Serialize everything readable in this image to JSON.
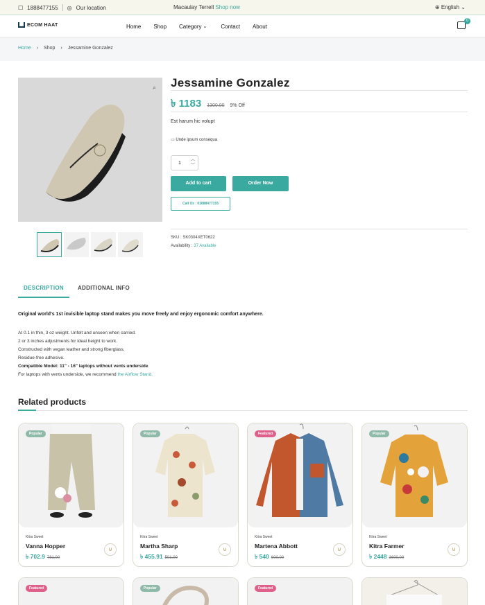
{
  "topbar": {
    "phone": "1888477155",
    "location": "Our location",
    "promo_name": "Macaulay Terrell",
    "promo_link": "Shop now",
    "language": "English"
  },
  "brand": {
    "name": "ECOM HAAT"
  },
  "nav": {
    "items": [
      "Home",
      "Shop",
      "Category",
      "Contact",
      "About"
    ],
    "cart_count": "0"
  },
  "breadcrumb": {
    "home": "Home",
    "shop": "Shop",
    "current": "Jessamine Gonzalez"
  },
  "product": {
    "title": "Jessamine Gonzalez",
    "price": "৳ 1183",
    "old_price": "1300.00",
    "discount": "9% Off",
    "short_desc": "Est harum hic volupt",
    "unde": "Unde ipsum consequa",
    "qty": "1",
    "add_to_cart": "Add to cart",
    "order_now": "Order Now",
    "call_us": "Call Us : 01888477155",
    "sku_label": "SKU :",
    "sku": "SK0304XET0622",
    "availability_label": "Availability :",
    "availability": "37 Available"
  },
  "tabs": {
    "description": "DESCRIPTION",
    "additional": "ADDITIONAL INFO"
  },
  "description": {
    "lead": "Original world's 1st invisible laptop stand makes you move freely and enjoy ergonomic comfort anywhere.",
    "lines": [
      "At 0.1 in thin, 3 oz weight. Unfelt and unseen when carried.",
      "2 or 3 inches adjustments for ideal height to work.",
      "Constructed with vegan leather and strong fiberglass.",
      "Residue-free adhesive."
    ],
    "compat": "Compatible Model: 11\" - 16\" laptops without vents underside",
    "vents_text": "For laptops with vents underside, we recommend",
    "vents_link": "the Airflow Stand."
  },
  "related": {
    "heading": "Related products",
    "cards": [
      {
        "badge": "Popular",
        "brand": "Kitra Sweet",
        "name": "Vanna Hopper",
        "price": "৳ 702.9",
        "old": "781.00"
      },
      {
        "badge": "Popular",
        "brand": "Kitra Sweet",
        "name": "Martha Sharp",
        "price": "৳ 455.91",
        "old": "501.00"
      },
      {
        "badge": "Featured",
        "brand": "Kitra Sweet",
        "name": "Martena Abbott",
        "price": "৳ 540",
        "old": "600.00"
      },
      {
        "badge": "Popular",
        "brand": "Kitra Sweet",
        "name": "Kitra Farmer",
        "price": "৳ 2448",
        "old": "3600.00"
      }
    ],
    "row2_badges": [
      "Featured",
      "Popular",
      "Featured",
      ""
    ]
  },
  "colors": {
    "accent": "#3aa99f",
    "popular_badge": "#8fb9a8",
    "featured_badge": "#e0608c"
  }
}
